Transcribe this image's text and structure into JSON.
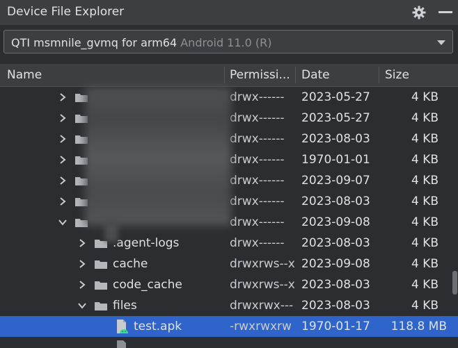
{
  "panel": {
    "title": "Device File Explorer"
  },
  "device": {
    "name": "QTI msmnile_gvmq for arm64",
    "os": "Android 11.0 (R)"
  },
  "columns": {
    "name": "Name",
    "permissions": "Permissi...",
    "date": "Date",
    "size": "Size"
  },
  "rows": [
    {
      "name": "",
      "permissions": "drwx------",
      "date": "2023-05-27",
      "size": "4 KB"
    },
    {
      "name": "",
      "permissions": "drwx------",
      "date": "2023-05-27",
      "size": "4 KB"
    },
    {
      "name": "",
      "permissions": "drwx------",
      "date": "2023-08-03",
      "size": "4 KB"
    },
    {
      "name": "",
      "permissions": "drwx------",
      "date": "1970-01-01",
      "size": "4 KB"
    },
    {
      "name": "",
      "permissions": "drwx------",
      "date": "2023-09-07",
      "size": "4 KB"
    },
    {
      "name": "",
      "permissions": "drwx------",
      "date": "2023-08-03",
      "size": "4 KB"
    },
    {
      "name": "",
      "permissions": "drwx------",
      "date": "2023-09-08",
      "size": "4 KB"
    },
    {
      "name": ".agent-logs",
      "permissions": "drwx------",
      "date": "2023-08-03",
      "size": "4 KB"
    },
    {
      "name": "cache",
      "permissions": "drwxrws--x",
      "date": "2023-09-08",
      "size": "4 KB"
    },
    {
      "name": "code_cache",
      "permissions": "drwxrws--x",
      "date": "2023-08-03",
      "size": "4 KB"
    },
    {
      "name": "files",
      "permissions": "drwxrwx---",
      "date": "2023-08-03",
      "size": "4 KB"
    },
    {
      "name": "test.apk",
      "permissions": "-rwxrwxrw",
      "date": "1970-01-17",
      "size": "118.8 MB"
    }
  ],
  "colors": {
    "accent": "#2f65ca",
    "folder": "#b4b8bc",
    "apk": "#3ddc84"
  },
  "icons": {
    "settings": "gear-icon",
    "minimize": "minimize-icon",
    "folder": "folder-icon",
    "apk": "android-apk-icon",
    "collapsed": "chevron-right-icon",
    "expanded": "chevron-down-icon"
  }
}
